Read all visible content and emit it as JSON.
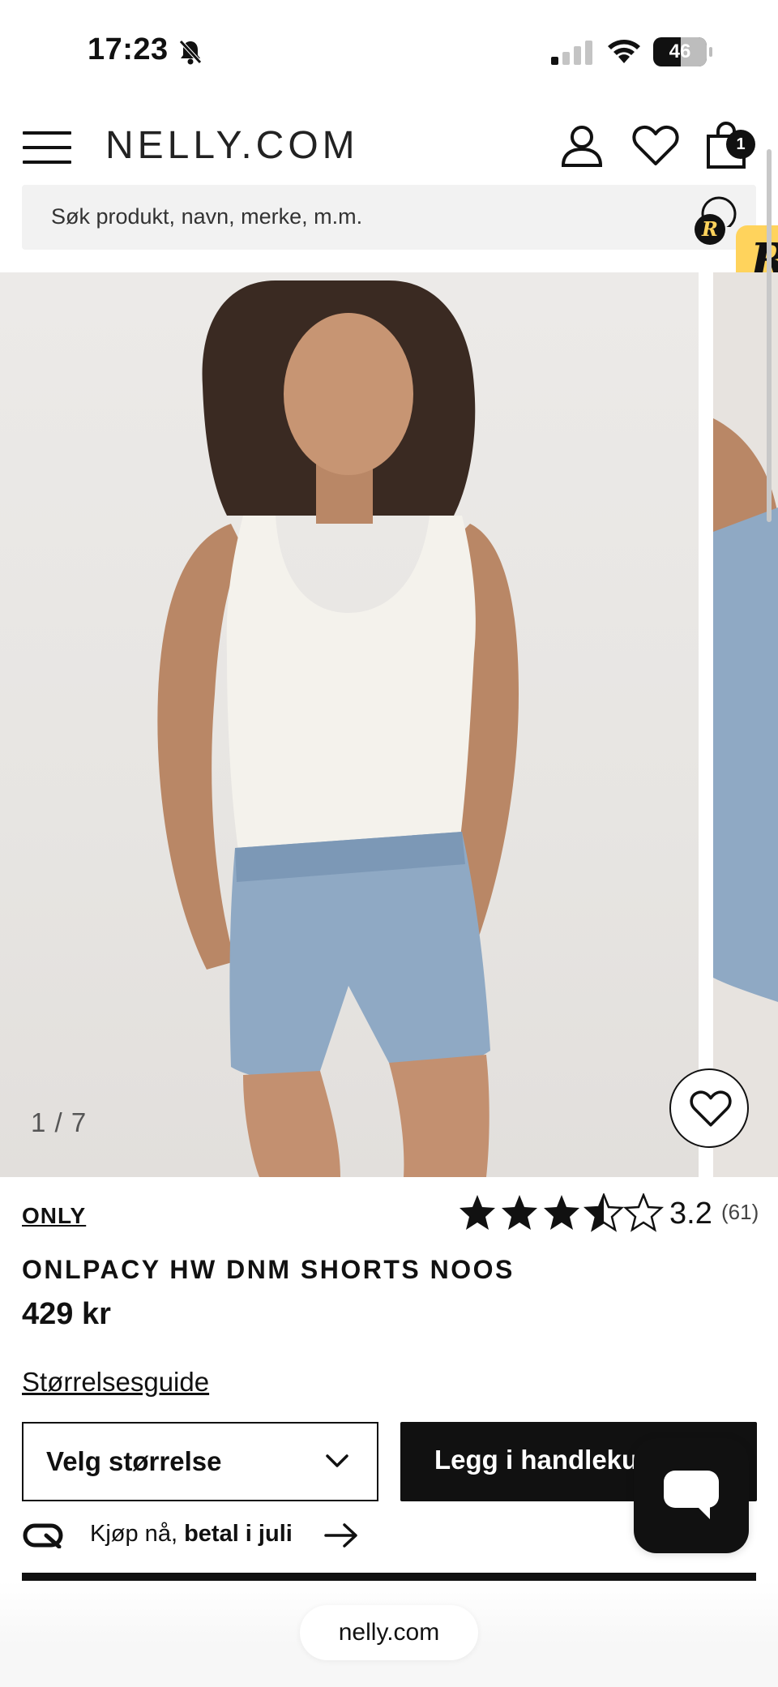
{
  "status_bar": {
    "time": "17:23",
    "battery_label": "46",
    "icons": [
      "bell-slash-icon",
      "cellular-signal-icon",
      "wifi-icon",
      "battery-icon"
    ]
  },
  "header": {
    "logo": "NELLY.COM",
    "bag_count": "1",
    "icons": [
      "hamburger-menu-icon",
      "account-icon",
      "heart-icon",
      "shopping-bag-icon"
    ]
  },
  "search": {
    "placeholder": "Søk produkt, navn, merke, m.m."
  },
  "gallery": {
    "counter": "1 / 7",
    "current_image": 1,
    "total_images": 7
  },
  "product": {
    "brand": "ONLY",
    "title": "ONLPACY HW DNM SHORTS NOOS",
    "price": "429 kr",
    "rating": {
      "value_text": "3.2",
      "count_text": "(61)",
      "value": 3.2,
      "max": 5
    }
  },
  "actions": {
    "size_guide": "Størrelsesguide",
    "size_select": "Velg størrelse",
    "add_to_cart": "Legg i handlekurv"
  },
  "klarna": {
    "prefix": "Kjøp nå, ",
    "bold": "betal i juli"
  },
  "browser": {
    "url": "nelly.com"
  },
  "colors": {
    "primary": "#111111",
    "search_bg": "#f2f2f2",
    "rakuten_yellow": "#ffd35c"
  }
}
